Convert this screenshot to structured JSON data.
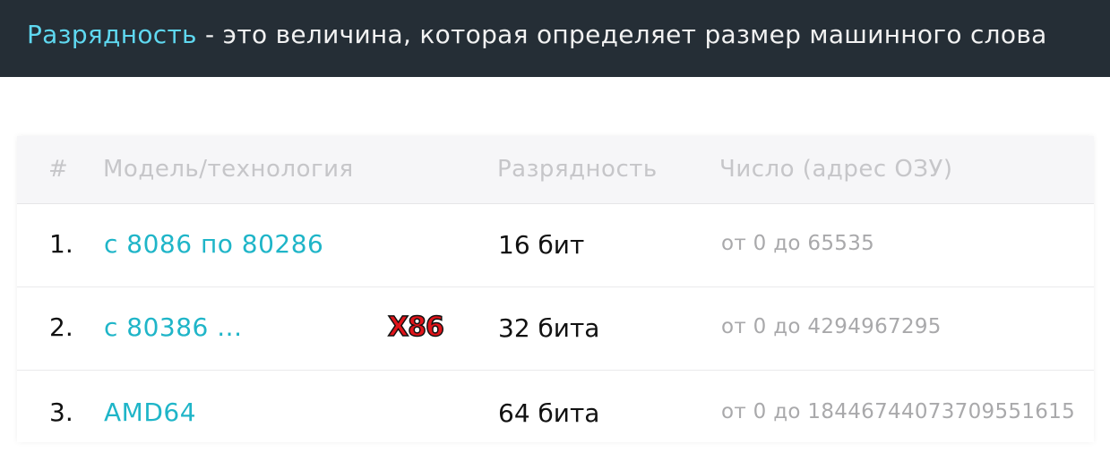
{
  "header": {
    "highlight": "Разрядность",
    "rest": " - это величина, которая определяет размер машинного слова"
  },
  "table": {
    "columns": [
      "#",
      "Модель/технология",
      "Разрядность",
      "Число (адрес ОЗУ)"
    ],
    "rows": [
      {
        "num": "1.",
        "model": "с 8086 по 80286",
        "badge": "",
        "bits": "16 бит",
        "address": "от 0 до 65535"
      },
      {
        "num": "2.",
        "model": "с 80386 ...",
        "badge": "X86",
        "bits": "32 бита",
        "address": "от 0 до 4294967295"
      },
      {
        "num": "3.",
        "model": "AMD64",
        "badge": "",
        "bits": "64 бита",
        "address": "от 0 до 18446744073709551615"
      }
    ]
  },
  "colors": {
    "header_bg": "#252e36",
    "highlight": "#5fd8f0",
    "link": "#1fb5c8",
    "badge": "#e1141a"
  }
}
